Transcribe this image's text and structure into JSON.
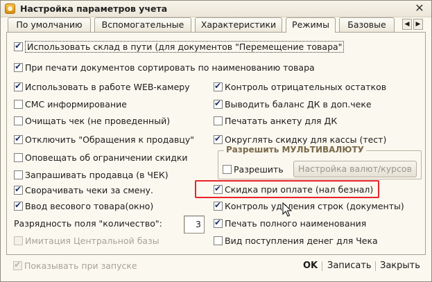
{
  "window": {
    "title": "Настройка параметров учета",
    "close": "✕"
  },
  "tabs": [
    {
      "label": "По умолчанию"
    },
    {
      "label": "Вспомогательные"
    },
    {
      "label": "Характеристики"
    },
    {
      "label": "Режимы"
    },
    {
      "label": "Базовые"
    }
  ],
  "tab_scroll": {
    "left": "◀",
    "right": "▶"
  },
  "options": {
    "wide": [
      {
        "label": "Использовать склад в пути (для документов \"Перемещение товара\"",
        "checked": true
      },
      {
        "label": "При печати документов сортировать по наименованию товара",
        "checked": true
      }
    ],
    "left": [
      {
        "label": "Использовать в работе WEB-камеру",
        "checked": true
      },
      {
        "label": "СМС информирование",
        "checked": false
      },
      {
        "label": "Очищать чек (не проведенный)",
        "checked": false
      },
      {
        "label": "Отключить \"Обращения к продавцу\"",
        "checked": true
      },
      {
        "label": "Оповещать об ограничении скидки",
        "checked": false
      },
      {
        "label": "Запрашивать продавца (в ЧЕК)",
        "checked": false
      },
      {
        "label": "Сворачивать чеки за смену.",
        "checked": true
      },
      {
        "label": "Ввод весового товара(окно)",
        "checked": true
      }
    ],
    "right": [
      {
        "label": "Контроль отрицательных остатков",
        "checked": true
      },
      {
        "label": "Выводить баланс ДК в доп.чеке",
        "checked": true
      },
      {
        "label": "Печатать анкету для ДК",
        "checked": false
      },
      {
        "label": "Округлять скидку для кассы (тест)",
        "checked": true
      }
    ],
    "right_lower": [
      {
        "label": "Скидка при оплате (нал безнал)",
        "checked": true
      },
      {
        "label": "Контроль удаления строк (документы)",
        "checked": true
      },
      {
        "label": "Печать полного наименования",
        "checked": true
      },
      {
        "label": "Вид поступления денег для Чека",
        "checked": false
      }
    ]
  },
  "multicurrency": {
    "legend": "Разрешить МУЛЬТИВАЛЮТУ",
    "allow_label": "Разрешить",
    "allow_checked": false,
    "settings_button": "Настройка валют/курсов"
  },
  "quantity_digits": {
    "label": "Разрядность поля \"количество\":",
    "value": "3"
  },
  "central_db": {
    "label": "Имитация Центральной базы",
    "checked": false
  },
  "footer": {
    "show_on_start": {
      "label": "Показывать при запуске",
      "checked": true
    },
    "ok": "OK",
    "save": "Записать",
    "close": "Закрыть"
  }
}
